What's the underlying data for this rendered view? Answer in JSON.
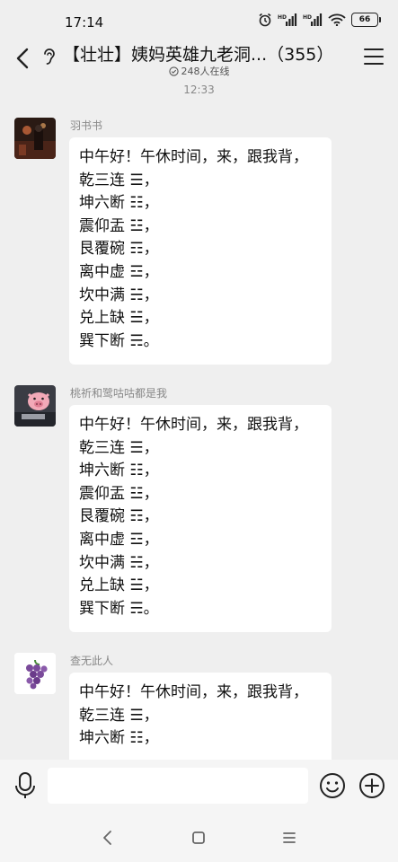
{
  "status_bar": {
    "time": "17:14",
    "battery": "66"
  },
  "header": {
    "title": "【壮壮】姨妈英雄九老洞...（355）",
    "online": "248人在线"
  },
  "timestamp": "12:33",
  "messages": [
    {
      "sender": "羽书书",
      "lines": [
        "中午好！午休时间，来，跟我背，",
        "乾三连 ☰，",
        "坤六断 ☷，",
        "震仰盂 ☳，",
        "艮覆碗 ☶，",
        "离中虚 ☲，",
        "坎中满 ☵，",
        "兑上缺 ☱，",
        "巽下断 ☴。"
      ]
    },
    {
      "sender": "桃祈和鹭咕咕都是我",
      "lines": [
        "中午好！午休时间，来，跟我背，",
        "乾三连 ☰，",
        "坤六断 ☷，",
        "震仰盂 ☳，",
        "艮覆碗 ☶，",
        "离中虚 ☲，",
        "坎中满 ☵，",
        "兑上缺 ☱，",
        "巽下断 ☴。"
      ]
    },
    {
      "sender": "查无此人",
      "lines": [
        "中午好！午休时间，来，跟我背，",
        "乾三连 ☰，",
        "坤六断 ☷，"
      ]
    }
  ],
  "input": {
    "placeholder": ""
  },
  "icons": {
    "back": "back-arrow-icon",
    "ear": "ear-icon",
    "menu": "menu-icon",
    "mic": "microphone-icon",
    "emoji": "smiley-icon",
    "plus": "plus-icon",
    "nav_back": "nav-back-icon",
    "nav_home": "nav-home-icon",
    "nav_recent": "nav-recent-icon"
  },
  "colors": {
    "background": "#efefef",
    "bubble": "#ffffff",
    "bars": "#f5f5f5"
  }
}
